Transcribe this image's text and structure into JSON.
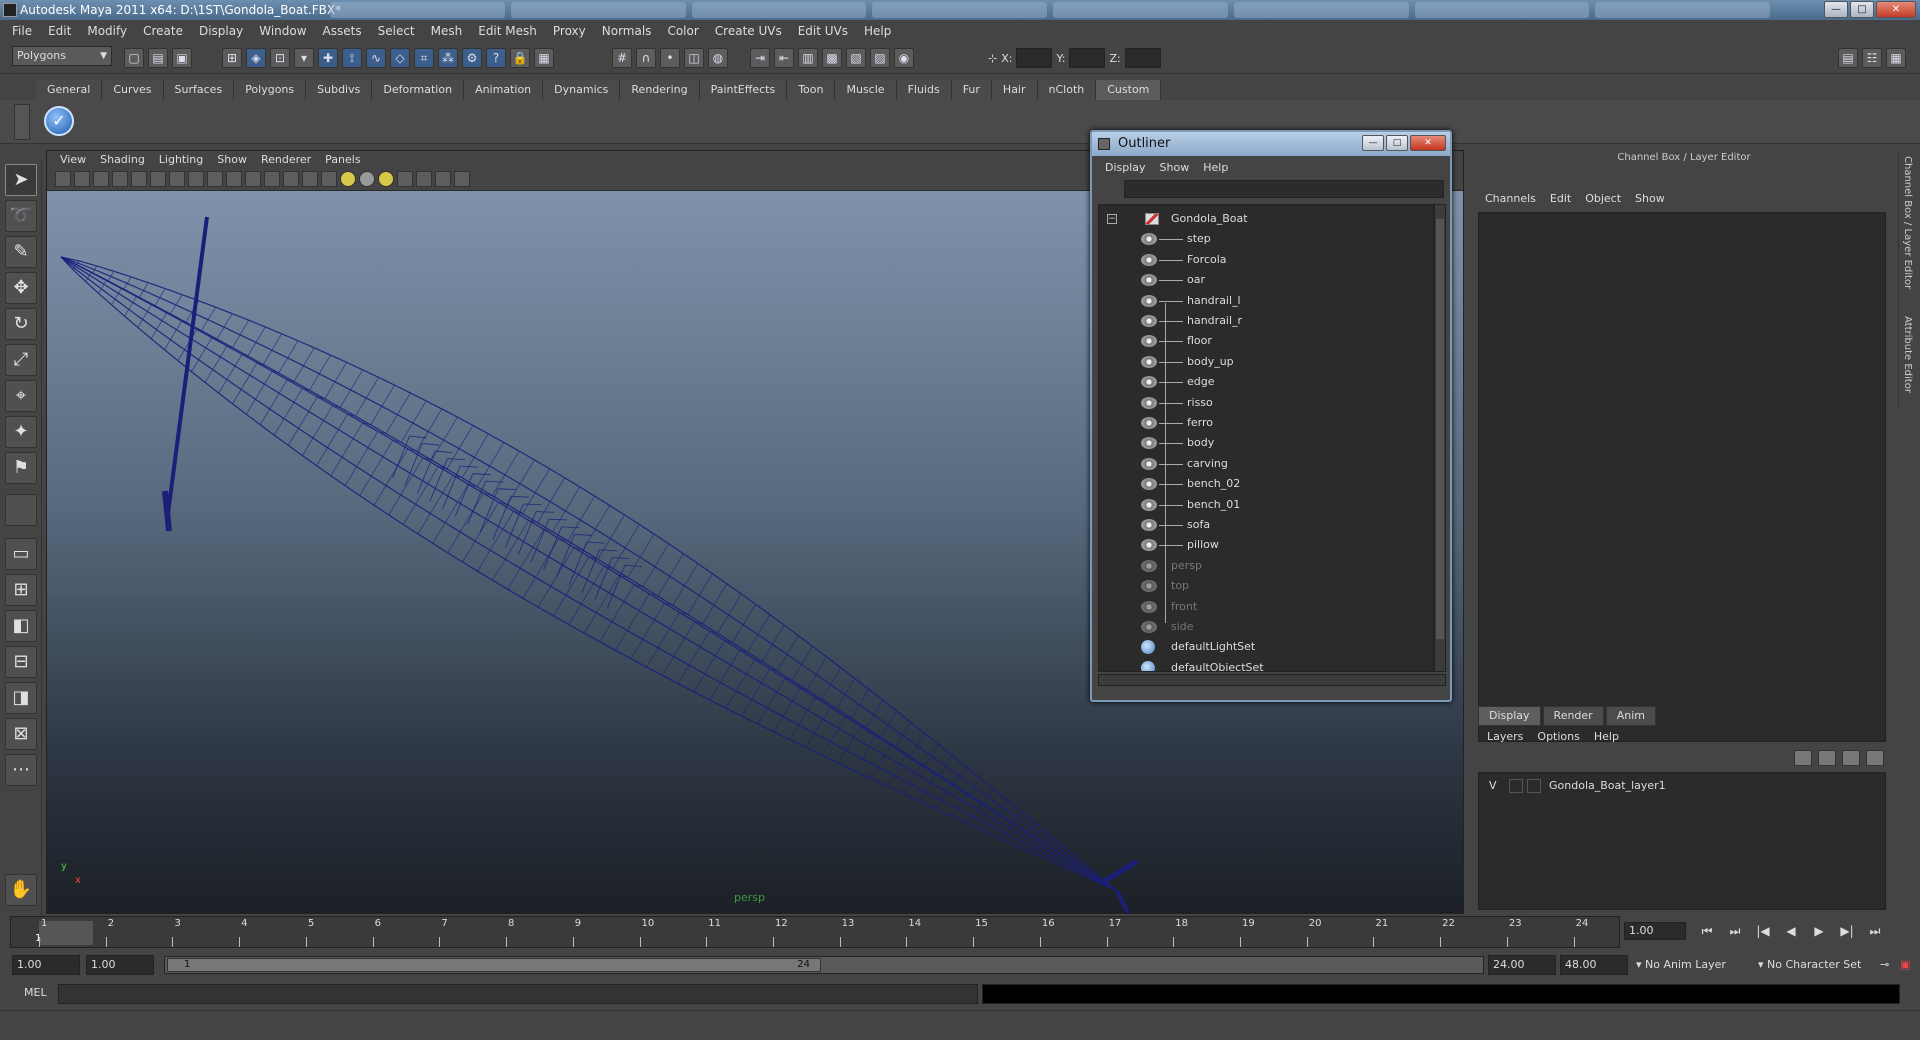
{
  "window": {
    "title": "Autodesk Maya 2011 x64: D:\\1ST\\Gondola_Boat.FBX*",
    "minimize": "—",
    "maximize": "□",
    "close": "✕"
  },
  "menus": [
    "File",
    "Edit",
    "Modify",
    "Create",
    "Display",
    "Window",
    "Assets",
    "Select",
    "Mesh",
    "Edit Mesh",
    "Proxy",
    "Normals",
    "Color",
    "Create UVs",
    "Edit UVs",
    "Help"
  ],
  "status": {
    "mode": "Polygons",
    "x_label": "X:",
    "y_label": "Y:",
    "z_label": "Z:"
  },
  "shelf": {
    "tabs": [
      "General",
      "Curves",
      "Surfaces",
      "Polygons",
      "Subdivs",
      "Deformation",
      "Animation",
      "Dynamics",
      "Rendering",
      "PaintEffects",
      "Toon",
      "Muscle",
      "Fluids",
      "Fur",
      "Hair",
      "nCloth",
      "Custom"
    ],
    "active": "Custom",
    "item_glyph": "✓"
  },
  "viewport": {
    "menus": [
      "View",
      "Shading",
      "Lighting",
      "Show",
      "Renderer",
      "Panels"
    ],
    "camera_label": "persp",
    "axis_y": "y",
    "axis_x": "x",
    "wire_color": "#1c1f7a"
  },
  "outliner": {
    "title": "Outliner",
    "menus": [
      "Display",
      "Show",
      "Help"
    ],
    "collapse": "−",
    "root": "Gondola_Boat",
    "children": [
      "step",
      "Forcola",
      "oar",
      "handrail_l",
      "handrail_r",
      "floor",
      "body_up",
      "edge",
      "risso",
      "ferro",
      "body",
      "carving",
      "bench_02",
      "bench_01",
      "sofa",
      "pillow"
    ],
    "cameras": [
      "persp",
      "top",
      "front",
      "side"
    ],
    "sets": [
      "defaultLightSet",
      "defaultObjectSet"
    ]
  },
  "channelbox": {
    "title": "Channel Box / Layer Editor",
    "menus": [
      "Channels",
      "Edit",
      "Object",
      "Show"
    ],
    "layer_tabs": [
      "Display",
      "Render",
      "Anim"
    ],
    "active_tab": "Display",
    "layer_menus": [
      "Layers",
      "Options",
      "Help"
    ],
    "layer": {
      "visible": "V",
      "name": "Gondola_Boat_layer1"
    },
    "side_tabs": [
      "Channel Box / Layer Editor",
      "Attribute Editor"
    ]
  },
  "timeline": {
    "ticks": [
      "1",
      "2",
      "3",
      "4",
      "5",
      "6",
      "7",
      "8",
      "9",
      "10",
      "11",
      "12",
      "13",
      "14",
      "15",
      "16",
      "17",
      "18",
      "19",
      "20",
      "21",
      "22",
      "23",
      "24"
    ],
    "current_marker": "1",
    "current_frame": "1.00",
    "play_glyphs": [
      "⏮",
      "⏭",
      "|◀",
      "◀",
      "▶",
      "▶|",
      "⏭"
    ]
  },
  "range": {
    "start": "1.00",
    "playback_start": "1.00",
    "thumb_start": "1",
    "thumb_end": "24",
    "playback_end": "24.00",
    "end": "48.00",
    "anim_layer": "No Anim Layer",
    "char_set": "No Character Set"
  },
  "command": {
    "label": "MEL"
  }
}
